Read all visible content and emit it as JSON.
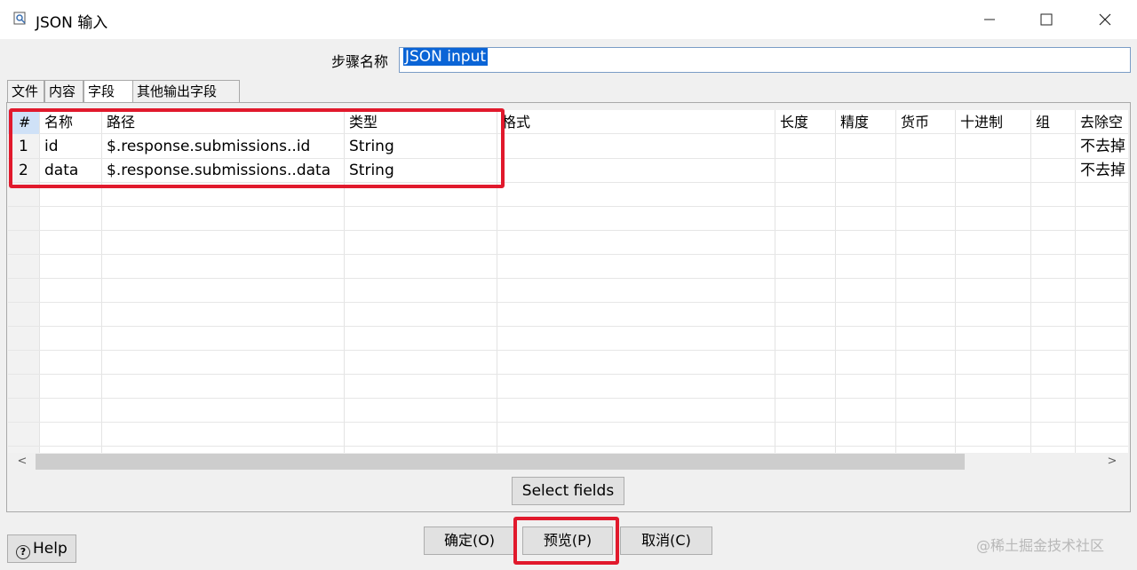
{
  "window": {
    "title": "JSON 输入",
    "minimize": "—",
    "maximize": "☐",
    "close": "✕"
  },
  "step": {
    "label": "步骤名称",
    "value": "JSON input"
  },
  "tabs": [
    {
      "label": "文件"
    },
    {
      "label": "内容"
    },
    {
      "label": "字段",
      "active": true
    },
    {
      "label": "其他输出字段"
    }
  ],
  "table": {
    "headers": [
      "#",
      "名称",
      "路径",
      "类型",
      "格式",
      "长度",
      "精度",
      "货币",
      "十进制",
      "组",
      "去除空"
    ],
    "rows": [
      [
        "1",
        "id",
        "$.response.submissions..id",
        "String",
        "",
        "",
        "",
        "",
        "",
        "",
        "不去掉"
      ],
      [
        "2",
        "data",
        "$.response.submissions..data",
        "String",
        "",
        "",
        "",
        "",
        "",
        "",
        "不去掉"
      ]
    ]
  },
  "scroll": {
    "left_arrow": "<",
    "right_arrow": ">"
  },
  "buttons": {
    "select_fields": "Select fields",
    "ok": "确定(O)",
    "preview": "预览(P)",
    "cancel": "取消(C)",
    "help": "Help",
    "help_glyph": "?"
  },
  "watermark": "@稀土掘金技术社区",
  "colors": {
    "highlight": "#e1192c",
    "selection": "#0a64d6"
  }
}
